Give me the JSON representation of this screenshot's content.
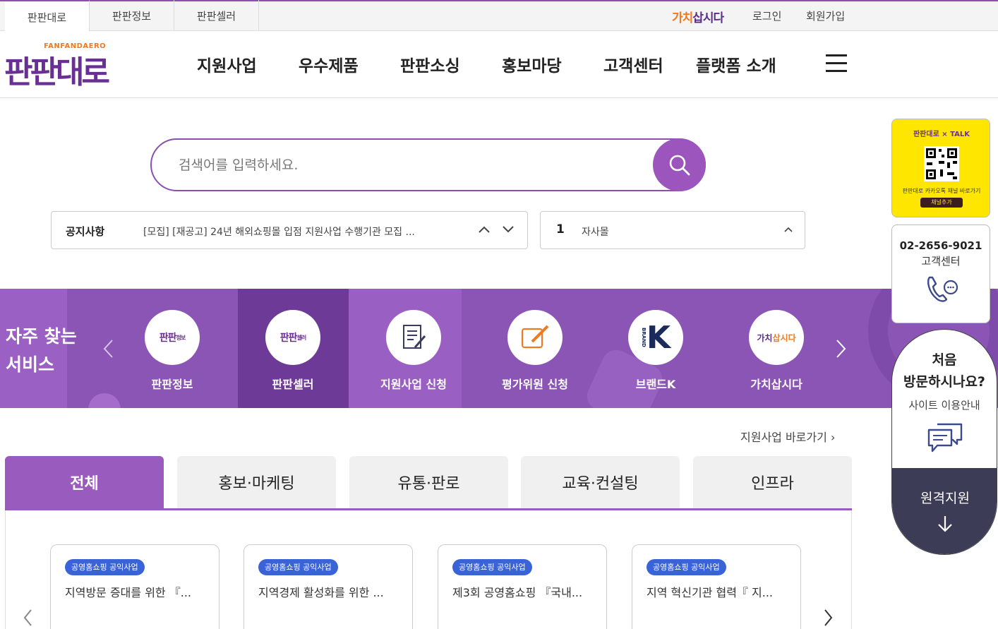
{
  "topbar": {
    "tabs": [
      "판판대로",
      "판판정보",
      "판판셀러"
    ],
    "gachi": {
      "part1": "가치",
      "part2": "삽시다"
    },
    "login": "로그인",
    "signup": "회원가입"
  },
  "header": {
    "logo_sub": "FANFANDAERO",
    "logo_main": "판판대로",
    "nav": [
      "지원사업",
      "우수제품",
      "판판소싱",
      "홍보마당",
      "고객센터",
      "플랫폼 소개"
    ]
  },
  "search": {
    "placeholder": "검색어를 입력하세요."
  },
  "notice": {
    "label": "공지사항",
    "text": "[모집] [재공고] 24년 해외쇼핑몰 입점 지원사업 수행기관 모집 ..."
  },
  "mall": {
    "index": "1",
    "name": "자사몰"
  },
  "services": {
    "title_line1": "자주 찾는",
    "title_line2": "서비스",
    "items": [
      {
        "name": "판판정보",
        "icon": "fanfan-info-logo",
        "mini": "판판",
        "mini2": "정보"
      },
      {
        "name": "판판셀러",
        "icon": "fanfan-seller-logo",
        "mini": "판판",
        "mini2": "셀러"
      },
      {
        "name": "지원사업 신청",
        "icon": "document-edit-icon"
      },
      {
        "name": "평가위원 신청",
        "icon": "pencil-edit-icon"
      },
      {
        "name": "브랜드K",
        "icon": "brand-k-logo",
        "mini": "K",
        "mini2": "BRAND"
      },
      {
        "name": "가치삽시다",
        "icon": "gachi-logo",
        "mini": "가치",
        "mini2": "삽시다"
      }
    ]
  },
  "support_link": "지원사업 바로가기",
  "categories": [
    "전체",
    "홍보·마케팅",
    "유통·판로",
    "교육·컨설팅",
    "인프라"
  ],
  "cards": [
    {
      "tag": "공영홈쇼핑 공익사업",
      "title": "지역방문 증대를 위한 『..."
    },
    {
      "tag": "공영홈쇼핑 공익사업",
      "title": "지역경제 활성화를 위한 ..."
    },
    {
      "tag": "공영홈쇼핑 공익사업",
      "title": "제3회 공영홈쇼핑 『국내..."
    },
    {
      "tag": "공영홈쇼핑 공익사업",
      "title": "지역 혁신기관 협력『 지..."
    }
  ],
  "quick": {
    "kakao_title": "판판대로 × TALK",
    "kakao_caption": "판판대로 카카오톡 채널 바로가기",
    "kakao_button": "채널추가",
    "phone": "02-2656-9021",
    "phone_label": "고객센터",
    "guide_line1": "처음",
    "guide_line2": "방문하시나요?",
    "guide_line3": "사이트 이용안내",
    "remote": "원격지원"
  },
  "colors": {
    "brand": "#8a4fb0",
    "accent": "#f07a22",
    "tag": "#3a63d8",
    "remote_bg": "#3c3c57"
  }
}
